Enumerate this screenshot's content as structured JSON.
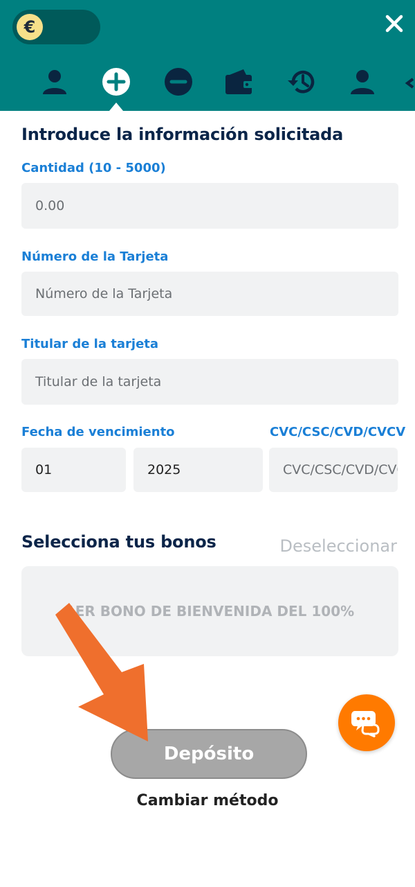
{
  "header": {
    "currency_symbol": "€",
    "tabs": [
      "profile-tab",
      "deposit-tab",
      "withdraw-tab",
      "wallet-tab",
      "history-tab",
      "account-tab"
    ]
  },
  "form": {
    "title": "Introduce la información solicitada",
    "amount": {
      "label": "Cantidad (10 - 5000)",
      "placeholder": "0.00"
    },
    "card_number": {
      "label": "Número de la Tarjeta",
      "placeholder": "Número de la Tarjeta"
    },
    "card_holder": {
      "label": "Titular de la tarjeta",
      "placeholder": "Titular de la tarjeta"
    },
    "expiry": {
      "label": "Fecha de vencimiento",
      "month": "01",
      "year": "2025"
    },
    "cvc": {
      "label": "CVC/CSC/CVD/CVCV",
      "placeholder": "CVC/CSC/CVD/CVCV"
    }
  },
  "bonus": {
    "title": "Selecciona tus bonos",
    "deselect": "Deseleccionar",
    "option": "1ER BONO DE BIENVENIDA DEL 100%"
  },
  "actions": {
    "deposit": "Depósito",
    "change_method": "Cambiar método"
  },
  "colors": {
    "header": "#008080",
    "accent_label": "#1a7fd6",
    "chat": "#ff7a00",
    "arrow": "#ef6f2d"
  }
}
